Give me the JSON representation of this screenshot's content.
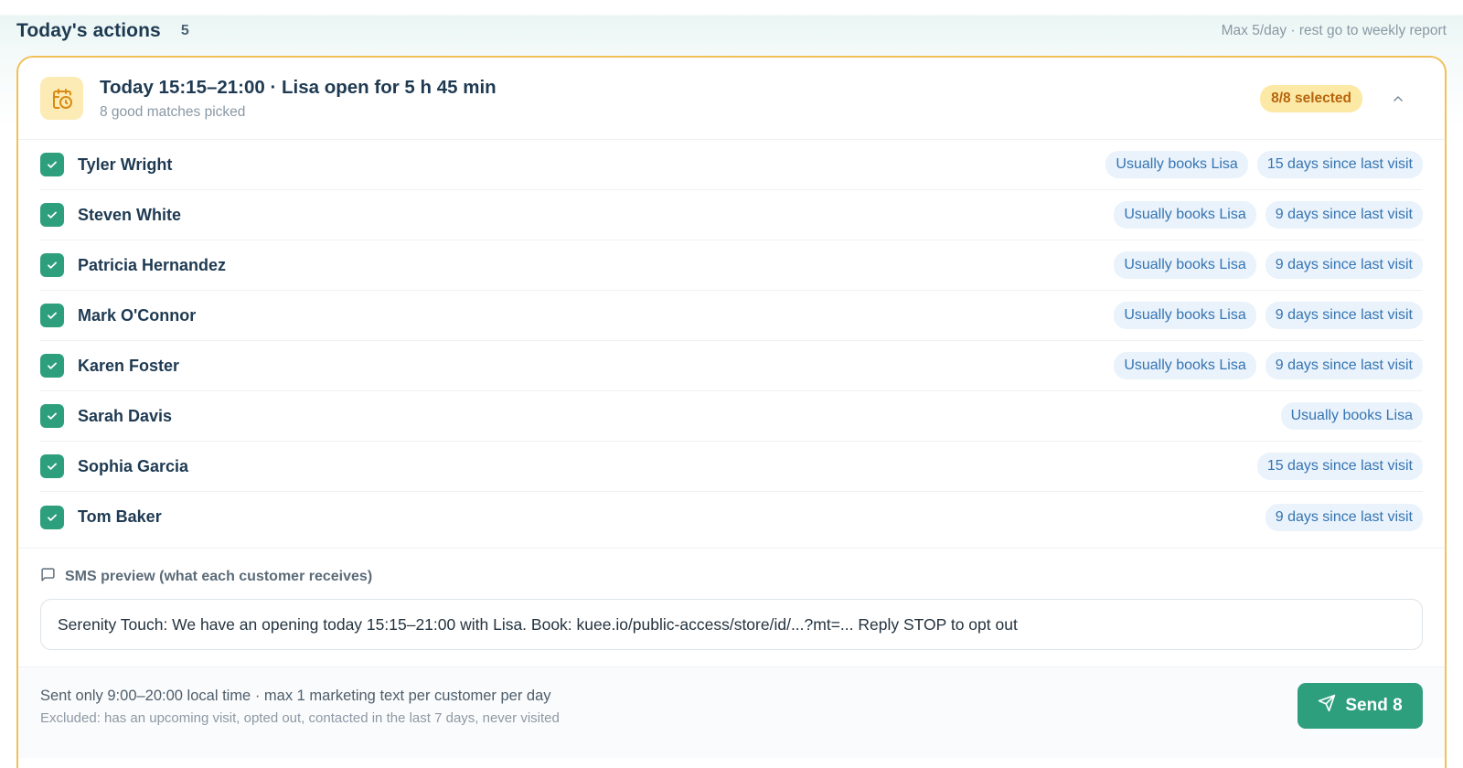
{
  "header": {
    "title": "Today's actions",
    "count": "5",
    "limit_note": "Max 5/day · rest go to weekly report"
  },
  "card": {
    "icon": "calendar-clock-icon",
    "title": "Today 15:15–21:00 · Lisa open for 5 h 45 min",
    "subtitle": "8 good matches picked",
    "selected_badge": "8/8 selected",
    "collapse_icon": "chevron-up-icon"
  },
  "rows": [
    {
      "name": "Tyler Wright",
      "checked": true,
      "tags": [
        "Usually books Lisa",
        "15 days since last visit"
      ]
    },
    {
      "name": "Steven White",
      "checked": true,
      "tags": [
        "Usually books Lisa",
        "9 days since last visit"
      ]
    },
    {
      "name": "Patricia Hernandez",
      "checked": true,
      "tags": [
        "Usually books Lisa",
        "9 days since last visit"
      ]
    },
    {
      "name": "Mark O'Connor",
      "checked": true,
      "tags": [
        "Usually books Lisa",
        "9 days since last visit"
      ]
    },
    {
      "name": "Karen Foster",
      "checked": true,
      "tags": [
        "Usually books Lisa",
        "9 days since last visit"
      ]
    },
    {
      "name": "Sarah Davis",
      "checked": true,
      "tags": [
        "Usually books Lisa"
      ]
    },
    {
      "name": "Sophia Garcia",
      "checked": true,
      "tags": [
        "15 days since last visit"
      ]
    },
    {
      "name": "Tom Baker",
      "checked": true,
      "tags": [
        "9 days since last visit"
      ]
    }
  ],
  "sms": {
    "icon": "message-square-icon",
    "label": "SMS preview (what each customer receives)",
    "text": "Serenity Touch: We have an opening today 15:15–21:00 with Lisa. Book: kuee.io/public-access/store/id/...?mt=... Reply STOP to opt out"
  },
  "footer": {
    "note": "Sent only 9:00–20:00 local time · max 1 marketing text per customer per day",
    "excluded": "Excluded: has an upcoming visit, opted out, contacted in the last 7 days, never visited",
    "send_icon": "send-icon",
    "send_label": "Send 8"
  },
  "colors": {
    "accent": "#2e9f7d",
    "card_border": "#f0c15a",
    "badge_bg": "#fde9a6",
    "badge_text": "#b7650c",
    "tag_bg": "#eaf3fb",
    "tag_text": "#3574b3"
  }
}
